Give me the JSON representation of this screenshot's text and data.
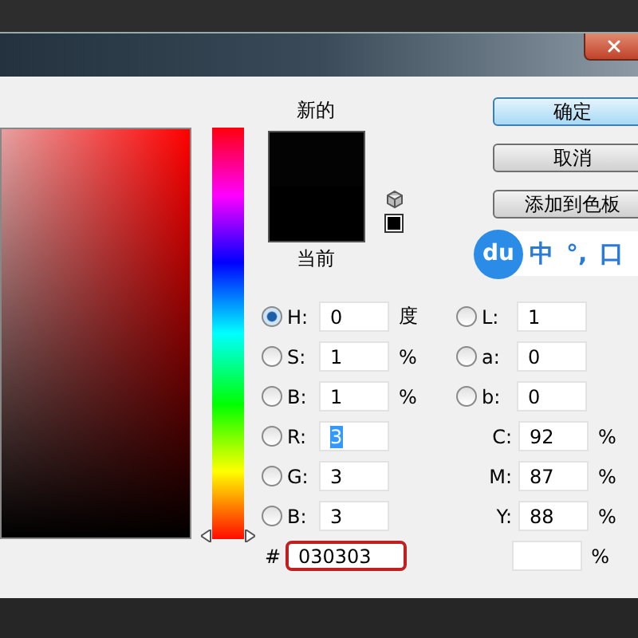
{
  "hue_slider": {
    "level": 0
  },
  "swatch": {
    "new_label": "新的",
    "current_label": "当前"
  },
  "buttons": [
    {
      "label": "确定",
      "default": true
    },
    {
      "label": "取消",
      "default": false
    },
    {
      "label": "添加到色板",
      "default": false
    }
  ],
  "ime_bar": {
    "logo": "du",
    "items": [
      "中",
      "°,",
      "口"
    ]
  },
  "rows": [
    {
      "left": {
        "kind": "radio",
        "label": "H:",
        "value": "0",
        "unit": "度",
        "selected": true
      },
      "right": {
        "kind": "radio",
        "label": "L:",
        "value": "1",
        "selected": false
      }
    },
    {
      "left": {
        "kind": "radio",
        "label": "S:",
        "value": "1",
        "unit": "%",
        "selected": false
      },
      "right": {
        "kind": "radio",
        "label": "a:",
        "value": "0",
        "selected": false
      }
    },
    {
      "left": {
        "kind": "radio",
        "label": "B:",
        "value": "1",
        "unit": "%",
        "selected": false
      },
      "right": {
        "kind": "radio",
        "label": "b:",
        "value": "0",
        "selected": false
      }
    },
    {
      "left": {
        "kind": "radio",
        "label": "R:",
        "value": "3",
        "selected": false,
        "text_selected": true
      },
      "right": {
        "kind": "plain",
        "label": "C:",
        "value": "92",
        "unit": "%"
      }
    },
    {
      "left": {
        "kind": "radio",
        "label": "G:",
        "value": "3",
        "selected": false
      },
      "right": {
        "kind": "plain",
        "label": "M:",
        "value": "87",
        "unit": "%"
      }
    },
    {
      "left": {
        "kind": "radio",
        "label": "B:",
        "value": "3",
        "selected": false
      },
      "right": {
        "kind": "plain",
        "label": "Y:",
        "value": "88",
        "unit": "%"
      }
    },
    {
      "left": {
        "kind": "hex",
        "label": "#",
        "value": "030303"
      },
      "right": {
        "kind": "plain",
        "unit": "%"
      }
    }
  ]
}
